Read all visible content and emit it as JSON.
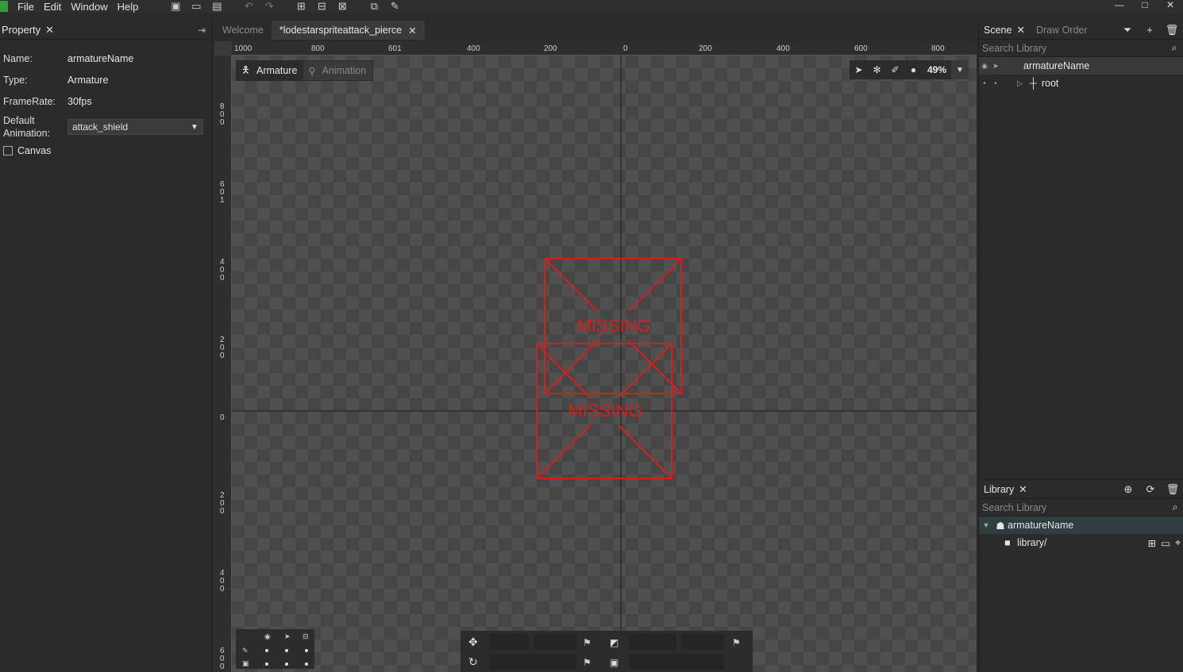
{
  "menu": {
    "items": [
      "File",
      "Edit",
      "Window",
      "Help"
    ]
  },
  "window_controls": [
    "—",
    "□",
    "✕"
  ],
  "property_panel": {
    "tab_label": "Property",
    "rows": [
      {
        "key": "Name:",
        "value": "armatureName"
      },
      {
        "key": "Type:",
        "value": "Armature"
      },
      {
        "key": "FrameRate:",
        "value": "30fps"
      }
    ],
    "default_animation_label_1": "Default",
    "default_animation_label_2": "Animation:",
    "default_animation_value": "attack_shield",
    "canvas_label": "Canvas"
  },
  "doc_tabs": [
    {
      "label": "Welcome"
    },
    {
      "label": "*lodestarspriteattack_pierce"
    }
  ],
  "ruler_top": [
    "1000",
    "800",
    "601",
    "400",
    "200",
    "0",
    "200",
    "400",
    "600",
    "800"
  ],
  "ruler_left": [
    "800",
    "601",
    "400",
    "200",
    "0",
    "200",
    "400",
    "600"
  ],
  "stage": {
    "mode_armature": "Armature",
    "mode_animation": "Animation",
    "zoom": "49%",
    "missing_1": "MISSING",
    "missing_2": "MISSING"
  },
  "scene_panel": {
    "tab_scene": "Scene",
    "tab_draw_order": "Draw Order",
    "search_placeholder": "Search Library",
    "tree": [
      {
        "label": "armatureName"
      },
      {
        "label": "root"
      }
    ]
  },
  "library_panel": {
    "tab_label": "Library",
    "search_placeholder": "Search Library",
    "items": [
      {
        "label": "armatureName"
      },
      {
        "label": "library/"
      }
    ]
  },
  "colors": {
    "accent": "#3a9a3a",
    "missing_red": "#d41f1f"
  }
}
